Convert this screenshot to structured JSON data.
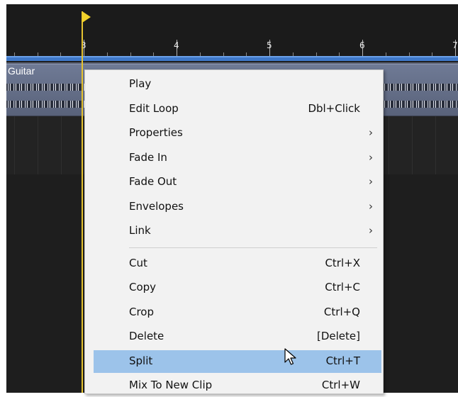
{
  "timeline": {
    "ruler_numbers": [
      "3",
      "4",
      "5",
      "6",
      "7"
    ]
  },
  "track": {
    "clip_name": "Guitar"
  },
  "context_menu": {
    "items": [
      {
        "label": "Play",
        "shortcut": "",
        "submenu": false
      },
      {
        "label": "Edit Loop",
        "shortcut": "Dbl+Click",
        "submenu": false
      },
      {
        "label": "Properties",
        "shortcut": "",
        "submenu": true
      },
      {
        "label": "Fade In",
        "shortcut": "",
        "submenu": true
      },
      {
        "label": "Fade Out",
        "shortcut": "",
        "submenu": true
      },
      {
        "label": "Envelopes",
        "shortcut": "",
        "submenu": true
      },
      {
        "label": "Link",
        "shortcut": "",
        "submenu": true
      },
      {
        "label": "Cut",
        "shortcut": "Ctrl+X",
        "submenu": false
      },
      {
        "label": "Copy",
        "shortcut": "Ctrl+C",
        "submenu": false
      },
      {
        "label": "Crop",
        "shortcut": "Ctrl+Q",
        "submenu": false
      },
      {
        "label": "Delete",
        "shortcut": "[Delete]",
        "submenu": false
      },
      {
        "label": "Split",
        "shortcut": "Ctrl+T",
        "submenu": false,
        "highlighted": true
      },
      {
        "label": "Mix To New Clip",
        "shortcut": "Ctrl+W",
        "submenu": false
      }
    ],
    "submenu_glyph": "›"
  },
  "colors": {
    "playhead": "#f2d22b",
    "loop_bar": "#3f78c9",
    "highlight": "#9cc3ea"
  },
  "icons": [
    "playhead-flag-icon",
    "mouse-cursor-icon",
    "submenu-arrow-icon"
  ]
}
